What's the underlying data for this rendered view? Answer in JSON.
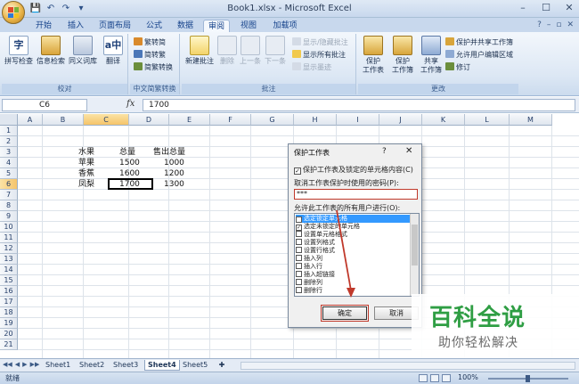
{
  "window": {
    "title": "Book1.xlsx - Microsoft Excel",
    "controls": {
      "minimize": "–",
      "maximize": "☐",
      "close": "✕"
    }
  },
  "quick_access": {
    "save": "💾",
    "undo": "↶",
    "redo": "↷",
    "customize": "▾"
  },
  "ribbon_tabs": [
    "开始",
    "插入",
    "页面布局",
    "公式",
    "数据",
    "审阅",
    "视图",
    "加载项"
  ],
  "active_tab": "审阅",
  "ribbon_right": {
    "help": "?",
    "min": "–",
    "restore": "▫",
    "close": "✕"
  },
  "ribbon": {
    "proofing": {
      "label": "校对",
      "spelling": "拼写检查",
      "research": "信息检索",
      "thesaurus": "同义词库",
      "translate": "翻译"
    },
    "chinese_convert": {
      "label": "中文简繁转换",
      "to_simplified": "繁转简",
      "to_traditional": "简转繁",
      "convert": "简繁转换"
    },
    "comments": {
      "label": "批注",
      "new": "新建批注",
      "delete": "删除",
      "previous": "上一条",
      "next": "下一条",
      "show_hide": "显示/隐藏批注",
      "show_all": "显示所有批注",
      "show_ink": "显示墨迹"
    },
    "changes": {
      "label": "更改",
      "protect_sheet_line1": "保护",
      "protect_sheet_line2": "工作表",
      "protect_workbook_line1": "保护",
      "protect_workbook_line2": "工作簿",
      "share_line1": "共享",
      "share_line2": "工作簿",
      "protect_share": "保护并共享工作簿",
      "allow_edit_ranges": "允许用户编辑区域",
      "track_changes": "修订"
    },
    "colors": {
      "accent": "#15428b",
      "ribbon_bg": "#dce7f4"
    }
  },
  "formula_bar": {
    "name_box": "C6",
    "fx_label": "fx",
    "value": "1700"
  },
  "columns": [
    "A",
    "B",
    "C",
    "D",
    "E",
    "F",
    "G",
    "H",
    "I",
    "J",
    "K",
    "L",
    "M"
  ],
  "selected_column": "C",
  "rows": [
    "1",
    "2",
    "3",
    "4",
    "5",
    "6",
    "7",
    "8",
    "9",
    "10",
    "11",
    "12",
    "13",
    "14",
    "15",
    "16",
    "17",
    "18",
    "19",
    "20",
    "21"
  ],
  "selected_row": "6",
  "cells": {
    "B4": "水果",
    "C4": "总量",
    "D4": "售出总量",
    "B5": "苹果",
    "C5": "1500",
    "D5": "1000",
    "B6": "香蕉",
    "C6": "1600",
    "D6": "1200",
    "B7": "凤梨",
    "C7": "1700",
    "D7": "1300"
  },
  "sheet_tabs": [
    "Sheet1",
    "Sheet2",
    "Sheet3",
    "Sheet4",
    "Sheet5"
  ],
  "active_sheet": "Sheet4",
  "status": {
    "ready": "就绪",
    "zoom": "100%",
    "zoom_out": "–",
    "zoom_in": "+"
  },
  "dialog": {
    "title": "保护工作表",
    "help": "?",
    "close": "✕",
    "protect_option": "保护工作表及锁定的单元格内容(C)",
    "password_label": "取消工作表保护时使用的密码(P):",
    "password_value": "***",
    "allow_label": "允许此工作表的所有用户进行(O):",
    "options": [
      {
        "label": "选定锁定单元格",
        "checked": true
      },
      {
        "label": "选定未锁定的单元格",
        "checked": true
      },
      {
        "label": "设置单元格格式",
        "checked": false
      },
      {
        "label": "设置列格式",
        "checked": false
      },
      {
        "label": "设置行格式",
        "checked": false
      },
      {
        "label": "插入列",
        "checked": false
      },
      {
        "label": "插入行",
        "checked": false
      },
      {
        "label": "插入超链接",
        "checked": false
      },
      {
        "label": "删除列",
        "checked": false
      },
      {
        "label": "删除行",
        "checked": false
      }
    ],
    "ok": "确定",
    "cancel": "取消",
    "highlight_color": "#c0392b"
  },
  "watermark": {
    "title": "百科全说",
    "subtitle": "助你轻松解决",
    "color": "#2f9e44"
  }
}
